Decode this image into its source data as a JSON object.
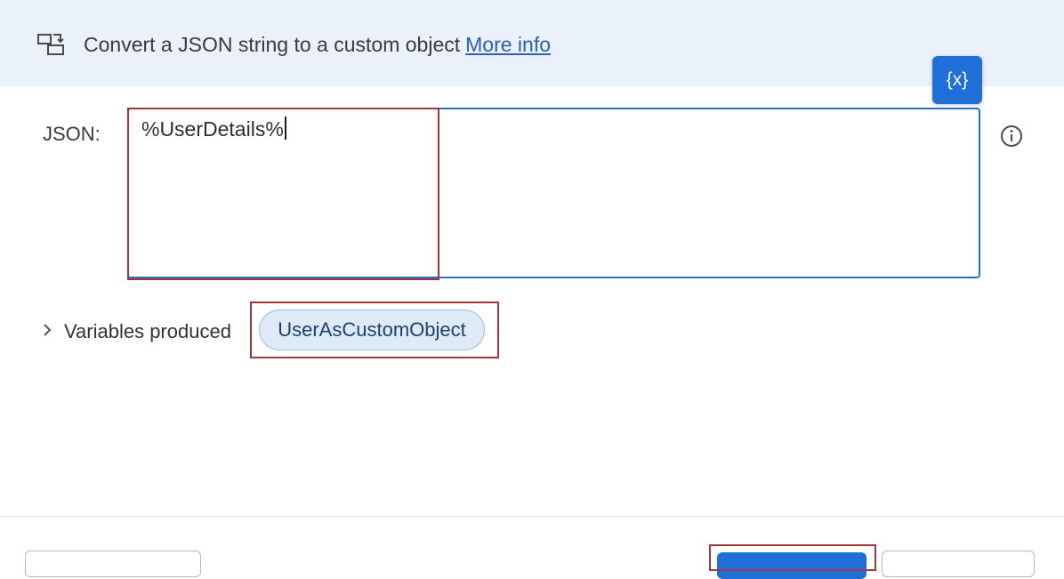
{
  "header": {
    "description": "Convert a JSON string to a custom object",
    "more_info_link": "More info",
    "icon": "convert-json-icon"
  },
  "form": {
    "json_label": "JSON:",
    "json_value": "%UserDetails%",
    "variable_button_label": "{x}",
    "info_icon": "info-icon"
  },
  "variables": {
    "toggle_label": "Variables produced",
    "chip_label": "UserAsCustomObject",
    "chevron_icon": "chevron-right-icon"
  },
  "colors": {
    "header_bg": "#eaf1fb",
    "accent": "#1f6fd9",
    "highlight": "#a5353c",
    "link": "#2a5fb3",
    "chip_bg": "#dfeaf7"
  }
}
